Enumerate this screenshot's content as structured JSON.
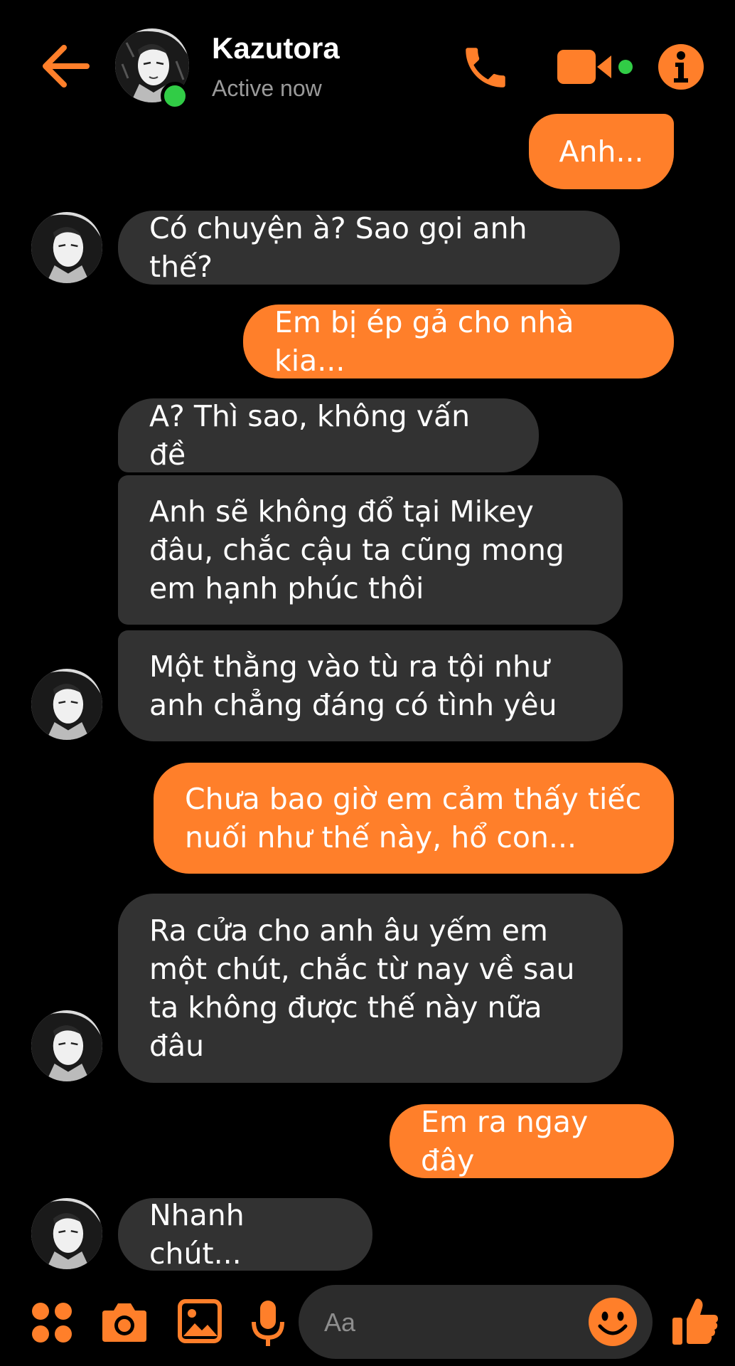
{
  "header": {
    "contact_name": "Kazutora",
    "status": "Active now",
    "icons": {
      "back": "back-arrow-icon",
      "call": "phone-icon",
      "video": "video-camera-icon",
      "info": "info-icon"
    }
  },
  "colors": {
    "accent": "#ff7f2a",
    "incoming_bubble": "#323232",
    "background": "#000000",
    "online": "#31cc46",
    "status_text": "#9a9a9a"
  },
  "messages": [
    {
      "direction": "out",
      "text": "Anh..."
    },
    {
      "direction": "in",
      "text": "Có chuyện à? Sao gọi anh thế?"
    },
    {
      "direction": "out",
      "text": "Em bị ép gả cho nhà kia..."
    },
    {
      "direction": "in",
      "text": "A? Thì sao, không vấn đề"
    },
    {
      "direction": "in",
      "text": "Anh sẽ không đổ tại Mikey\nđâu, chắc cậu ta cũng mong\nem hạnh phúc thôi"
    },
    {
      "direction": "in",
      "text": "Một thằng vào tù ra tội như\nanh chẳng đáng có tình yêu"
    },
    {
      "direction": "out",
      "text": "Chưa bao giờ em cảm thấy tiếc\nnuối như thế này, hổ con..."
    },
    {
      "direction": "in",
      "text": "Ra cửa cho anh âu yếm em\nmột chút, chắc từ nay về sau\nta không được thế này nữa\nđâu"
    },
    {
      "direction": "out",
      "text": "Em ra ngay đây"
    },
    {
      "direction": "in",
      "text": "Nhanh chút..."
    }
  ],
  "composer": {
    "placeholder": "Aa",
    "icons": {
      "menu": "grid-dots-icon",
      "camera": "camera-icon",
      "gallery": "image-icon",
      "mic": "microphone-icon",
      "emoji": "smiley-icon",
      "like": "thumbs-up-icon"
    }
  }
}
